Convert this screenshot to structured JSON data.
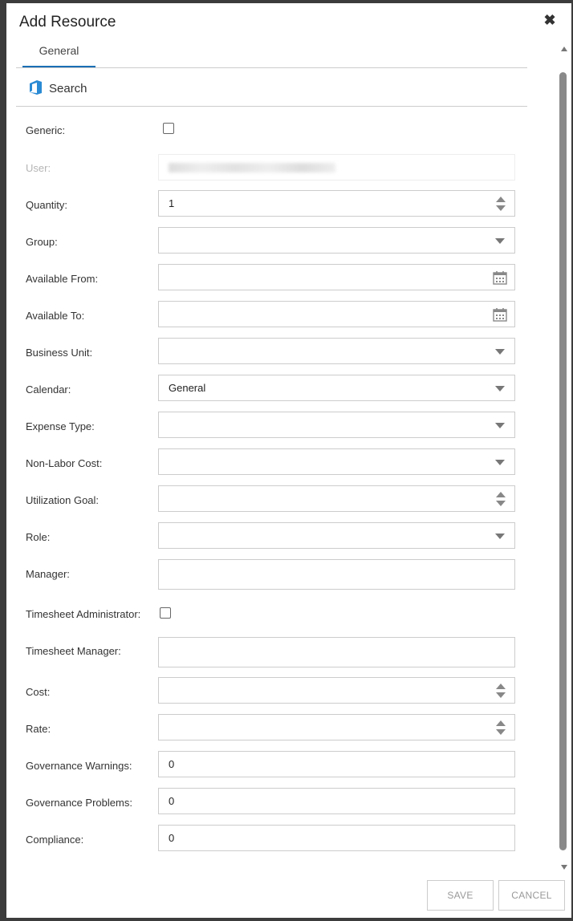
{
  "dialog": {
    "title": "Add Resource",
    "tabs": [
      {
        "label": "General"
      }
    ],
    "search_label": "Search"
  },
  "form": {
    "generic_label": "Generic:",
    "user_label": "User:",
    "quantity_label": "Quantity:",
    "quantity_value": "1",
    "group_label": "Group:",
    "group_value": "",
    "available_from_label": "Available From:",
    "available_from_value": "",
    "available_to_label": "Available To:",
    "available_to_value": "",
    "business_unit_label": "Business Unit:",
    "business_unit_value": "",
    "calendar_label": "Calendar:",
    "calendar_value": "General",
    "expense_type_label": "Expense Type:",
    "expense_type_value": "",
    "non_labor_cost_label": "Non-Labor Cost:",
    "non_labor_cost_value": "",
    "utilization_goal_label": "Utilization Goal:",
    "utilization_goal_value": "",
    "role_label": "Role:",
    "role_value": "",
    "manager_label": "Manager:",
    "manager_value": "",
    "timesheet_admin_label": "Timesheet Administrator:",
    "timesheet_manager_label": "Timesheet Manager:",
    "timesheet_manager_value": "",
    "cost_label": "Cost:",
    "cost_value": "",
    "rate_label": "Rate:",
    "rate_value": "",
    "governance_warnings_label": "Governance Warnings:",
    "governance_warnings_value": "0",
    "governance_problems_label": "Governance Problems:",
    "governance_problems_value": "0",
    "compliance_label": "Compliance:",
    "compliance_value": "0"
  },
  "footer": {
    "save_label": "SAVE",
    "cancel_label": "CANCEL"
  },
  "colors": {
    "accent": "#1a6fb5",
    "office_icon": "#2a8ad4",
    "backdrop": "#3c3c3c"
  },
  "icons": {
    "close": "close-icon",
    "office": "office-icon",
    "calendar": "calendar-icon",
    "dropdown": "chevron-down-icon",
    "spinner": "spinner-icon"
  }
}
